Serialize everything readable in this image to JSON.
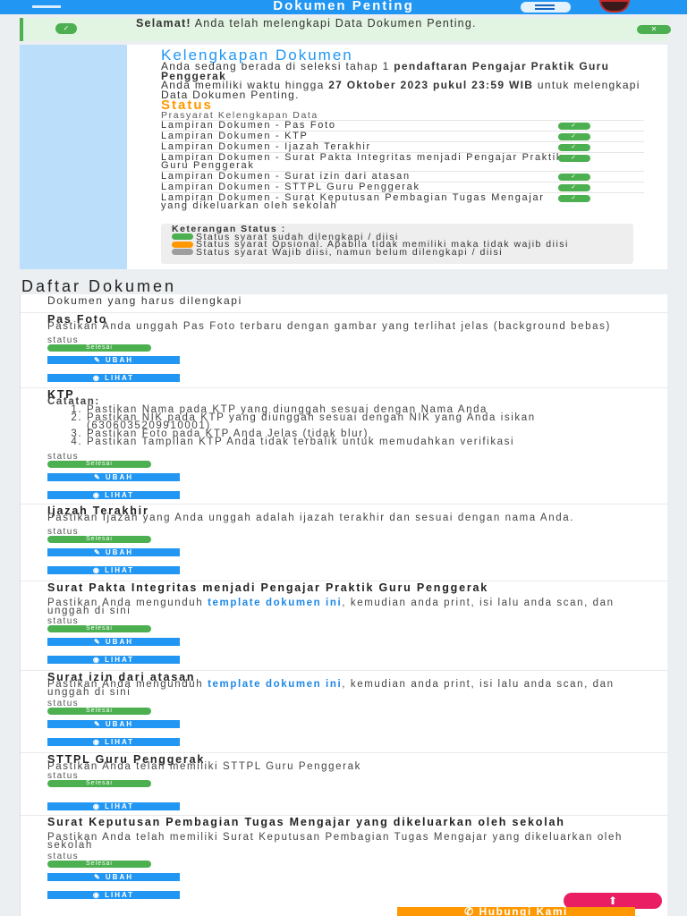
{
  "navbar": {
    "title": "Dokumen Penting",
    "menu_icon": "hamburger-icon",
    "avatar_icon": "avatar"
  },
  "alert": {
    "bold": "Selamat!",
    "text": " Anda telah melengkapi Data Dokumen Penting."
  },
  "info": {
    "title": "Kelengkapan Dokumen",
    "intro_a": "Anda sedang berada di seleksi tahap 1 ",
    "intro_b": "pendaftaran Pengajar Praktik Guru Penggerak",
    "deadline_a": "Anda memiliki waktu hingga ",
    "deadline_b": "27 Oktober 2023 pukul 23:59 WIB",
    "deadline_c": " untuk melengkapi Data Dokumen Penting.",
    "status_title": "Status",
    "requirements_title": "Prasyarat Kelengkapan Data",
    "requirements": [
      "Lampiran Dokumen - Pas Foto",
      "Lampiran Dokumen - KTP",
      "Lampiran Dokumen - Ijazah Terakhir",
      "Lampiran Dokumen - Surat Pakta Integritas menjadi Pengajar Praktik Guru Penggerak",
      "Lampiran Dokumen - Surat izin dari atasan",
      "Lampiran Dokumen - STTPL Guru Penggerak",
      "Lampiran Dokumen - Surat Keputusan Pembagian Tugas Mengajar yang dikeluarkan oleh sekolah"
    ],
    "legend": {
      "title": "Keterangan Status :",
      "items": [
        "Status syarat sudah dilengkapi / diisi",
        "Status syarat Opsional. Apabila tidak memiliki maka tidak wajib diisi",
        "Status syarat Wajib diisi, namun belum dilengkapi / diisi"
      ]
    }
  },
  "documents": {
    "section_title": "Daftar Dokumen",
    "subtitle": "Dokumen yang harus dilengkapi",
    "status_label": "status",
    "status_value": "Selesai",
    "edit_label": "UBAH",
    "view_label": "LIHAT",
    "items": [
      {
        "title": "Pas Foto",
        "desc": "Pastikan Anda unggah Pas Foto terbaru dengan gambar yang terlihat jelas (background bebas)"
      },
      {
        "title": "KTP",
        "note": "Catatan:",
        "points": [
          "Pastikan Nama pada KTP yang diunggah sesuai dengan Nama Anda",
          "Pastikan NIK pada KTP yang diunggah sesuai dengan NIK yang Anda isikan (6306035209910001)",
          "Pastikan Foto pada KTP Anda Jelas (tidak blur)",
          "Pastikan Tampilan KTP Anda tidak terbalik untuk memudahkan verifikasi"
        ]
      },
      {
        "title": "Ijazah Terakhir",
        "desc": "Pastikan Ijazah yang Anda unggah adalah ijazah terakhir dan sesuai dengan nama Anda."
      },
      {
        "title": "Surat Pakta Integritas menjadi Pengajar Praktik Guru Penggerak",
        "desc_a": "Pastikan Anda mengunduh ",
        "link": "template dokumen ini",
        "desc_b": ", kemudian anda print, isi lalu anda scan, dan unggah di sini"
      },
      {
        "title": "Surat izin dari atasan",
        "desc_a": "Pastikan Anda mengunduh ",
        "link": "template dokumen ini",
        "desc_b": ", kemudian anda print, isi lalu anda scan, dan unggah di sini"
      },
      {
        "title": "STTPL Guru Penggerak",
        "desc": "Pastikan Anda telah memiliki STTPL Guru Penggerak"
      },
      {
        "title": "Surat Keputusan Pembagian Tugas Mengajar yang dikeluarkan oleh sekolah",
        "desc": "Pastikan Anda telah memiliki Surat Keputusan Pembagian Tugas Mengajar yang dikeluarkan oleh sekolah"
      }
    ]
  },
  "colors": {
    "primary": "#2196f3",
    "success": "#4caf50",
    "warning": "#ff9800",
    "fab": "#e91e63"
  },
  "fab_icon": "arrow-up-icon",
  "contact_label": "Hubungi Kami"
}
